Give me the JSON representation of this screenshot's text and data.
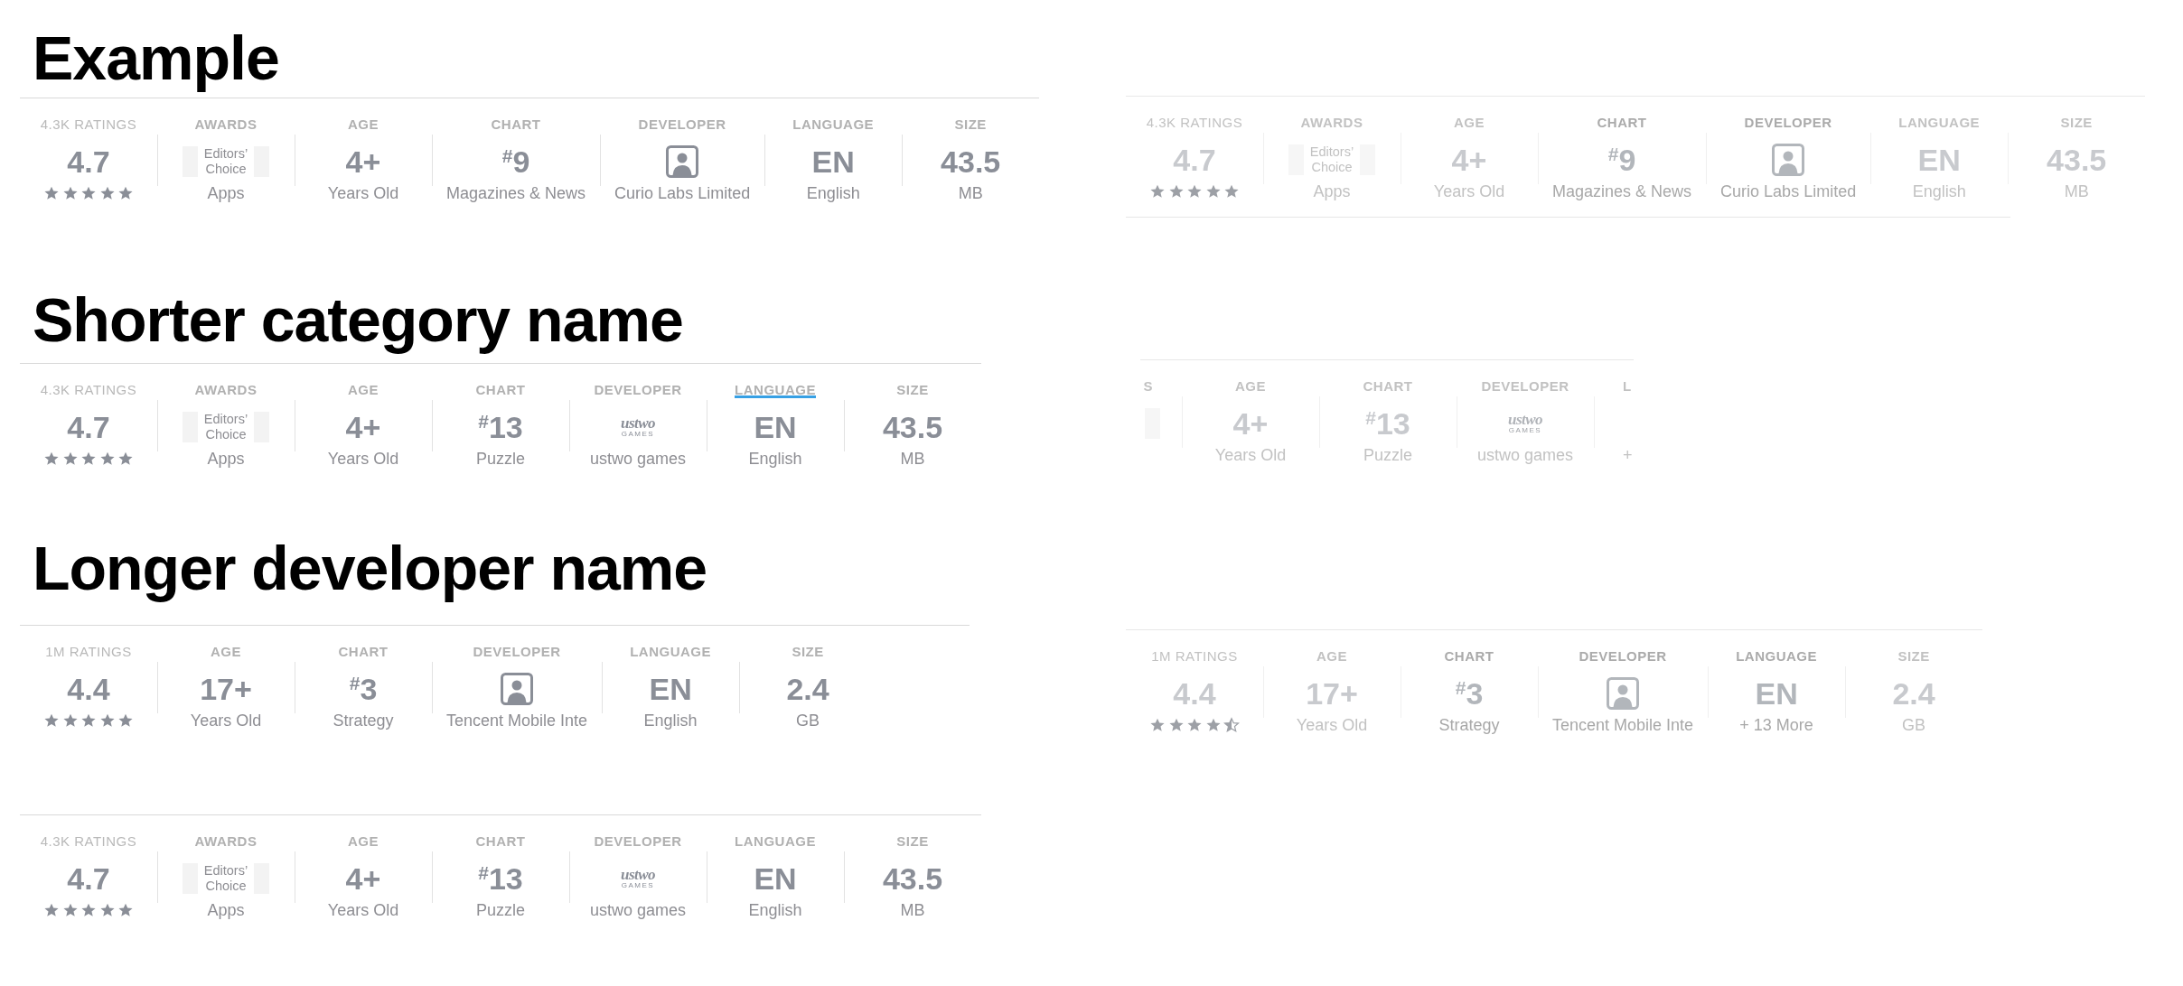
{
  "sections": [
    {
      "title": "Example",
      "strip": [
        {
          "kind": "ratings",
          "label": "4.3K RATINGS",
          "value": "4.7",
          "stars": 5
        },
        {
          "kind": "awards",
          "label": "AWARDS",
          "award": "Editors’ Choice",
          "sub": "Apps"
        },
        {
          "kind": "age",
          "label": "AGE",
          "value": "4+",
          "sub": "Years Old"
        },
        {
          "kind": "chart",
          "label": "CHART",
          "value": "$^{#}$9",
          "sub": "Magazines & News"
        },
        {
          "kind": "developer",
          "label": "DEVELOPER",
          "sub": "Curio Labs Limited"
        },
        {
          "kind": "language",
          "label": "LANGUAGE",
          "value": "EN",
          "sub": "English"
        },
        {
          "kind": "size",
          "label": "SIZE",
          "value": "43.5",
          "sub": "MB"
        }
      ]
    },
    {
      "title": "Shorter category name",
      "strip": [
        {
          "kind": "ratings",
          "label": "4.3K RATINGS",
          "value": "4.7",
          "stars": 5,
          "underlined": false
        },
        {
          "kind": "awards",
          "label": "AWARDS",
          "award": "Editors’ Choice",
          "sub": "Apps",
          "underlined": false
        },
        {
          "kind": "age",
          "label": "AGE",
          "value": "4+",
          "sub": "Years Old",
          "underlined": false
        },
        {
          "kind": "chart",
          "label": "CHART",
          "value": "$^{#}$13",
          "sub": "Puzzle",
          "underlined": false
        },
        {
          "kind": "developer",
          "label": "DEVELOPER",
          "logo": "ustwo",
          "logo_tagline": "GAMES",
          "sub": "ustwo games",
          "underlined": false
        },
        {
          "kind": "language",
          "label": "LANGUAGE",
          "value": "EN",
          "sub": "English",
          "underlined": true
        },
        {
          "kind": "size",
          "label": "SIZE",
          "value": "43.5",
          "sub": "MB",
          "underlined": false
        }
      ]
    },
    {
      "title": "Longer developer name",
      "strip": [
        {
          "kind": "ratings",
          "label": "1M RATINGS",
          "value": "4.4",
          "stars": 5
        },
        {
          "kind": "age",
          "label": "AGE",
          "value": "17+",
          "sub": "Years Old"
        },
        {
          "kind": "chart",
          "label": "CHART",
          "value": "$^{#}$3",
          "sub": "Strategy"
        },
        {
          "kind": "developer",
          "label": "DEVELOPER",
          "sub": "Tencent Mobile Inte"
        },
        {
          "kind": "language",
          "label": "LANGUAGE",
          "value": "EN",
          "sub": "English"
        },
        {
          "kind": "size",
          "label": "SIZE",
          "value": "2.4",
          "sub": "GB"
        }
      ]
    },
    {
      "strip": [
        {
          "kind": "ratings",
          "label": "4.3K RATINGS",
          "value": "4.7",
          "stars": 5
        },
        {
          "kind": "awards",
          "label": "AWARDS",
          "award": "Editors’ Choice",
          "sub": "Apps"
        },
        {
          "kind": "age",
          "label": "AGE",
          "value": "4+",
          "sub": "Years Old"
        },
        {
          "kind": "chart",
          "label": "CHART",
          "value": "$^{#}$13",
          "sub": "Puzzle"
        },
        {
          "kind": "developer",
          "label": "DEVELOPER",
          "logo": "ustwo",
          "logo_tagline": "GAMES",
          "sub": "ustwo games"
        },
        {
          "kind": "language",
          "label": "LANGUAGE",
          "value": "EN",
          "sub": "English"
        },
        {
          "kind": "size",
          "label": "SIZE",
          "value": "43.5",
          "sub": "MB"
        }
      ]
    }
  ],
  "previews": [
    {
      "cropped": false,
      "bottom_rule": true,
      "strip": [
        {
          "kind": "ratings",
          "label": "4.3K RATINGS",
          "value": "4.7",
          "stars": 5,
          "highlighted": false
        },
        {
          "kind": "awards",
          "label": "AWARDS",
          "award": "Editors’ Choice",
          "sub": "Apps",
          "highlighted": false
        },
        {
          "kind": "age",
          "label": "AGE",
          "value": "4+",
          "sub": "Years Old",
          "highlighted": false
        },
        {
          "kind": "chart",
          "label": "CHART",
          "value": "$^{#}$9",
          "sub": "Magazines & News",
          "highlighted": true
        },
        {
          "kind": "developer",
          "label": "DEVELOPER",
          "sub": "Curio Labs Limited",
          "highlighted": true
        },
        {
          "kind": "language",
          "label": "LANGUAGE",
          "value": "EN",
          "sub": "English",
          "highlighted": false
        },
        {
          "kind": "size",
          "label": "SIZE",
          "value": "43.5",
          "sub": "MB",
          "highlighted": false
        }
      ]
    },
    {
      "cropped": true,
      "bottom_rule": false,
      "strip": [
        {
          "kind": "awards",
          "label": "S",
          "highlighted": false
        },
        {
          "kind": "age",
          "label": "AGE",
          "value": "4+",
          "sub": "Years Old",
          "highlighted": false
        },
        {
          "kind": "chart",
          "label": "CHART",
          "value": "$^{#}$13",
          "sub": "Puzzle",
          "highlighted": false
        },
        {
          "kind": "developer",
          "label": "DEVELOPER",
          "logo": "ustwo",
          "logo_tagline": "GAMES",
          "sub": "ustwo games",
          "highlighted": false
        },
        {
          "kind": "language",
          "label": "L",
          "sub": "+",
          "highlighted": false
        }
      ]
    },
    {
      "cropped": false,
      "bottom_rule": false,
      "strip": [
        {
          "kind": "ratings",
          "label": "1M RATINGS",
          "value": "4.4",
          "stars": 4.5,
          "highlighted": false
        },
        {
          "kind": "age",
          "label": "AGE",
          "value": "17+",
          "sub": "Years Old",
          "highlighted": false
        },
        {
          "kind": "chart",
          "label": "CHART",
          "value": "$^{#}$3",
          "sub": "Strategy",
          "highlighted": true
        },
        {
          "kind": "developer",
          "label": "DEVELOPER",
          "sub": "Tencent Mobile Inte",
          "highlighted": true
        },
        {
          "kind": "language",
          "label": "LANGUAGE",
          "value": "EN",
          "sub": "+ 13 More",
          "highlighted": true
        },
        {
          "kind": "size",
          "label": "SIZE",
          "value": "2.4",
          "sub": "GB",
          "highlighted": false
        }
      ]
    }
  ]
}
